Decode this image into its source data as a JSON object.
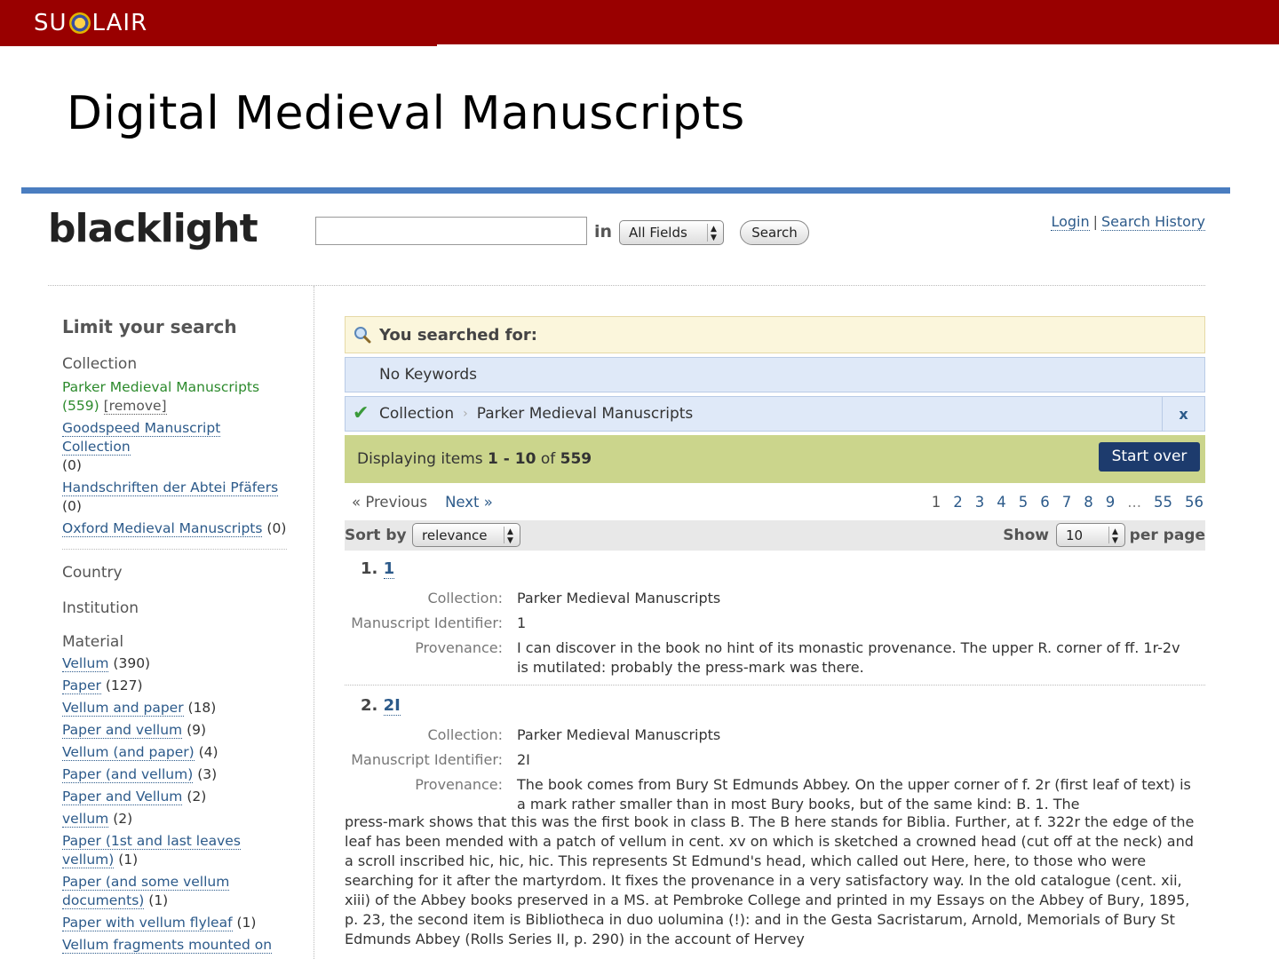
{
  "slide": {
    "logo_left": "SU",
    "logo_right": "LAIR",
    "title": "Digital Medieval Manuscripts"
  },
  "header": {
    "brand": "blacklight",
    "search": {
      "value": "",
      "placeholder": ""
    },
    "in_label": "in",
    "field_select": "All Fields",
    "search_button": "Search",
    "login": "Login",
    "separator": "|",
    "search_history": "Search History"
  },
  "sidebar": {
    "heading": "Limit your search",
    "collection": {
      "title": "Collection",
      "selected": {
        "label": "Parker Medieval Manuscripts",
        "count": "(559)",
        "remove": "[remove]"
      },
      "items": [
        {
          "label": "Goodspeed Manuscript Collection",
          "count": "(0)"
        },
        {
          "label": "Handschriften der Abtei Pfäfers",
          "count": "(0)"
        },
        {
          "label": "Oxford Medieval Manuscripts",
          "count": "(0)"
        }
      ]
    },
    "country": "Country",
    "institution": "Institution",
    "material": {
      "title": "Material",
      "items": [
        {
          "label": "Vellum",
          "count": "(390)"
        },
        {
          "label": "Paper",
          "count": "(127)"
        },
        {
          "label": "Vellum and paper",
          "count": "(18)"
        },
        {
          "label": "Paper and vellum",
          "count": "(9)"
        },
        {
          "label": "Vellum (and paper)",
          "count": "(4)"
        },
        {
          "label": "Paper (and vellum)",
          "count": "(3)"
        },
        {
          "label": "Paper and Vellum",
          "count": "(2)"
        },
        {
          "label": "vellum",
          "count": "(2)"
        },
        {
          "label": "Paper (1st and last leaves vellum)",
          "count": "(1)"
        },
        {
          "label": "Paper (and some vellum documents)",
          "count": "(1)"
        },
        {
          "label": "Paper with vellum flyleaf",
          "count": "(1)"
        },
        {
          "label": "Vellum fragments mounted on",
          "count": ""
        }
      ]
    }
  },
  "main": {
    "searched_for": "You searched for:",
    "no_keywords": "No Keywords",
    "constraint": {
      "field": "Collection",
      "value": "Parker Medieval Manuscripts",
      "remove": "x"
    },
    "results": {
      "prefix": "Displaying items",
      "range": "1 - 10",
      "of": "of",
      "total": "559",
      "start_over": "Start over"
    },
    "pager": {
      "previous": "« Previous",
      "next": "Next »",
      "pages": [
        "1",
        "2",
        "3",
        "4",
        "5",
        "6",
        "7",
        "8",
        "9",
        "...",
        "55",
        "56"
      ]
    },
    "sort": {
      "label": "Sort by",
      "value": "relevance",
      "show_label": "Show",
      "per_value": "10",
      "per_label": "per page"
    },
    "documents": [
      {
        "index": "1.",
        "title": "1",
        "collection_label": "Collection:",
        "collection": "Parker Medieval Manuscripts",
        "identifier_label": "Manuscript Identifier:",
        "identifier": "1",
        "provenance_label": "Provenance:",
        "provenance": "I can discover in the book no hint of its monastic provenance. The upper R. corner of ff. 1r-2v is mutilated: probably the press-mark was there."
      },
      {
        "index": "2.",
        "title": "2I",
        "collection_label": "Collection:",
        "collection": "Parker Medieval Manuscripts",
        "identifier_label": "Manuscript Identifier:",
        "identifier": "2I",
        "provenance_label": "Provenance:",
        "provenance_first": "The book comes from Bury St Edmunds Abbey. On the upper corner of f. 2r (first leaf of text) is a mark rather smaller than in most Bury books, but of the same kind: B. 1. The",
        "provenance_rest": "press-mark shows that this was the first book in class B. The B here stands for Biblia. Further, at f. 322r the edge of the leaf has been mended with a patch of vellum in cent. xv on which is sketched a crowned head (cut off at the neck) and a scroll inscribed hic, hic, hic. This represents St Edmund's head, which called out Here, here, to those who were searching for it after the martyrdom. It fixes the provenance in a very satisfactory way. In the old catalogue (cent. xii, xiii) of the Abbey books preserved in a MS. at Pembroke College and printed in my Essays on the Abbey of Bury, 1895, p. 23, the second item is Bibliotheca in duo uolumina (!): and in the Gesta Sacristarum, Arnold, Memorials of Bury St Edmunds Abbey (Rolls Series II, p. 290) in the account of Hervey"
      }
    ]
  },
  "colors": {
    "topbar": "#990000",
    "blue_rule": "#4a7dc0",
    "link": "#2c5a8a",
    "results_bar": "#cbd58c",
    "start_over": "#1d3b6d"
  }
}
